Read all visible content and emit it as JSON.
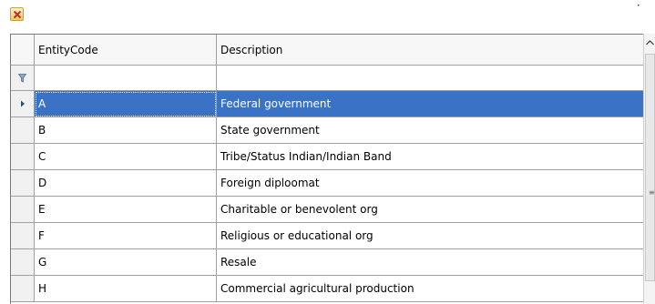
{
  "toolbar": {
    "close_icon": "close-x-icon"
  },
  "grid": {
    "columns": [
      "EntityCode",
      "Description"
    ],
    "rows": [
      {
        "code": "A",
        "description": "Federal government",
        "selected": true
      },
      {
        "code": "B",
        "description": "State government"
      },
      {
        "code": "C",
        "description": "Tribe/Status Indian/Indian Band"
      },
      {
        "code": "D",
        "description": "Foreign diploomat"
      },
      {
        "code": "E",
        "description": "Charitable or benevolent org"
      },
      {
        "code": "F",
        "description": "Religious or educational org"
      },
      {
        "code": "G",
        "description": "Resale"
      },
      {
        "code": "H",
        "description": "Commercial agricultural production"
      }
    ]
  },
  "colors": {
    "selection": "#3a73c6",
    "close_button": "#f6c65a"
  }
}
